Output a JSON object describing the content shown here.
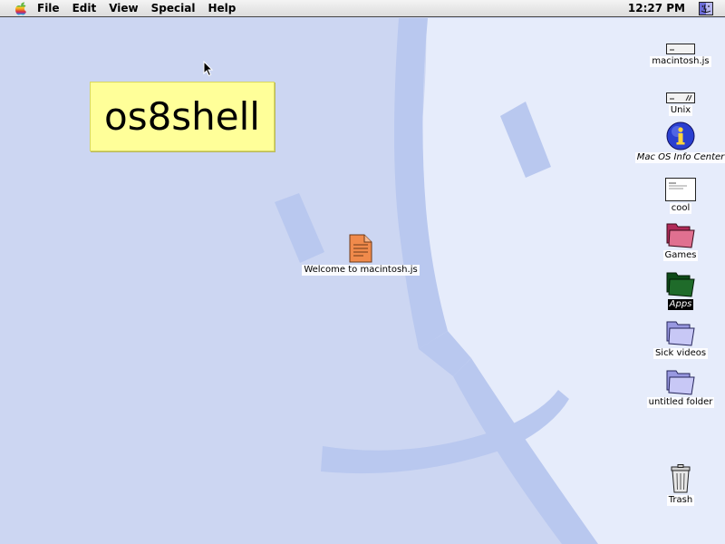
{
  "menubar": {
    "apple_icon": "apple-icon",
    "items": [
      {
        "label": "File"
      },
      {
        "label": "Edit"
      },
      {
        "label": "View"
      },
      {
        "label": "Special"
      },
      {
        "label": "Help"
      }
    ],
    "clock": "12:27 PM",
    "finder_icon": "finder-icon"
  },
  "sticky_note": {
    "text": "os8shell"
  },
  "desktop": {
    "file": {
      "label": "Welcome to macintosh.js",
      "icon": "document-icon"
    },
    "icons": [
      {
        "label": "macintosh.js",
        "icon": "hard-drive-icon"
      },
      {
        "label": "Unix",
        "icon": "hard-drive-icon"
      },
      {
        "label": "Mac OS Info Center",
        "icon": "info-icon"
      },
      {
        "label": "cool",
        "icon": "text-document-icon"
      },
      {
        "label": "Games",
        "icon": "folder-icon",
        "color": "#c04870"
      },
      {
        "label": "Apps",
        "icon": "folder-icon",
        "color": "#1f6b2a"
      },
      {
        "label": "Sick videos",
        "icon": "folder-icon",
        "color": "#b8b8f0"
      },
      {
        "label": "untitled folder",
        "icon": "folder-icon",
        "color": "#b8b8f0"
      },
      {
        "label": "Trash",
        "icon": "trash-icon"
      }
    ]
  },
  "colors": {
    "desktop_background": "#ccd6f2",
    "wallpaper_accent": "#b9c8ef",
    "wallpaper_face": "#e6ecfb",
    "sticky_note": "#ffff99",
    "document": "#f08a4b"
  }
}
